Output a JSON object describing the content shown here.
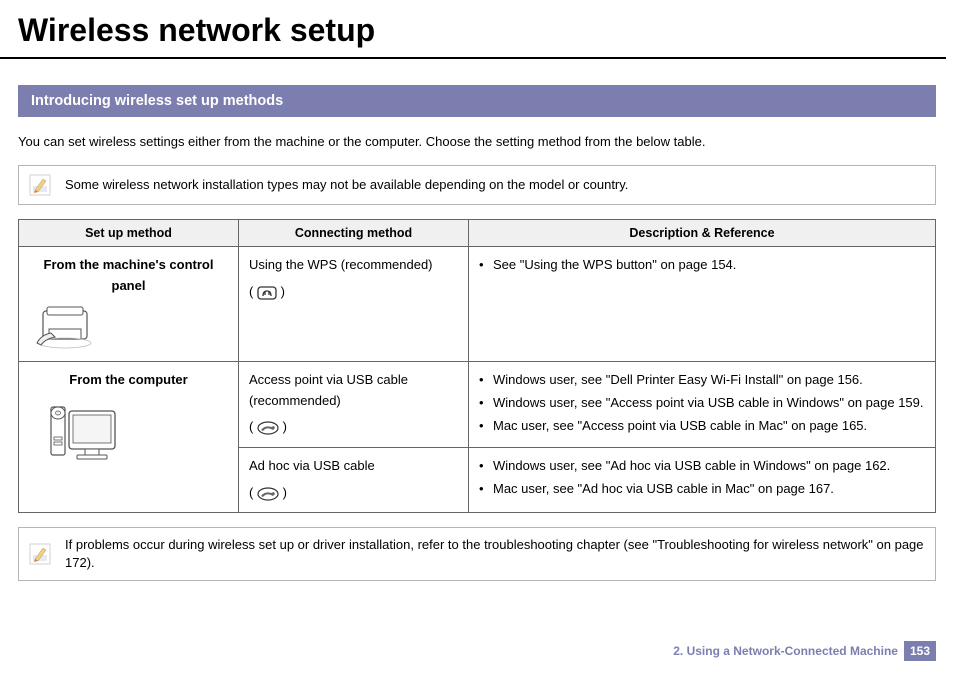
{
  "page": {
    "title": "Wireless network setup",
    "section_heading": "Introducing wireless set up methods",
    "intro": "You can set wireless settings either from the machine or the computer. Choose the setting method from the below table.",
    "note1": "Some wireless network installation types may not be available depending on the model or country.",
    "note2": "If problems occur during wireless set up or driver installation, refer to the troubleshooting chapter (see \"Troubleshooting for wireless network\" on page 172).",
    "footer_chapter": "2.  Using a Network-Connected Machine",
    "footer_page": "153"
  },
  "table": {
    "headers": {
      "col1": "Set up method",
      "col2": "Connecting method",
      "col3": "Description & Reference"
    },
    "row1": {
      "method": "From the machine's control panel",
      "connecting": "Using the WPS (recommended)",
      "paren_prefix": "(",
      "paren_suffix": ")",
      "desc1": "See \"Using the WPS button\" on page 154."
    },
    "row2": {
      "method": "From the computer",
      "connecting_a": "Access point via USB cable (recommended)",
      "paren_a_prefix": "(",
      "paren_a_suffix": ")",
      "desc_a1": "Windows user, see \"Dell Printer Easy Wi-Fi Install\" on page 156.",
      "desc_a2": "Windows user, see \"Access point via USB cable in Windows\" on page 159.",
      "desc_a3": "Mac user, see \"Access point via USB cable in Mac\" on page 165.",
      "connecting_b": "Ad hoc via USB cable",
      "paren_b_prefix": "(",
      "paren_b_suffix": ")",
      "desc_b1": "Windows user, see \"Ad hoc via USB cable in Windows\" on page 162.",
      "desc_b2": "Mac user, see \"Ad hoc via USB cable in Mac\" on page 167."
    }
  }
}
